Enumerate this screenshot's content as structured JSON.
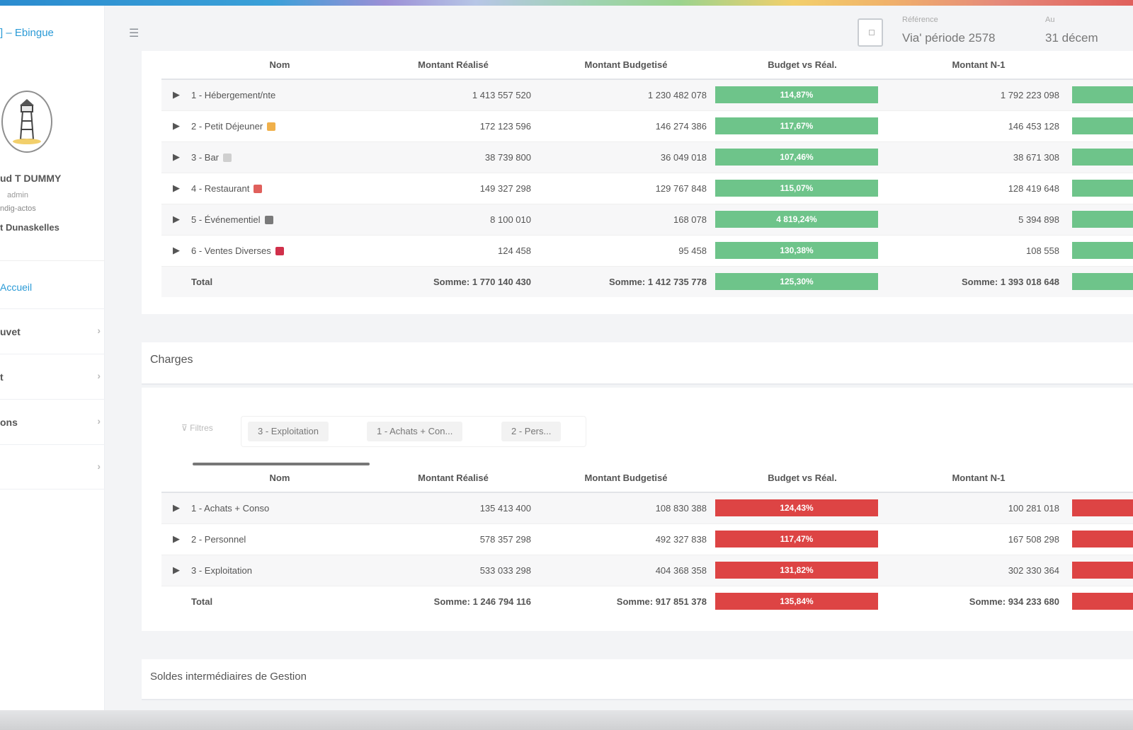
{
  "header": {
    "brand": "] – Ebingue",
    "date_label_1": "Référence",
    "date_value_1": "Via' période 2578",
    "date_label_2": "Au",
    "date_value_2": "31 décem"
  },
  "user": {
    "name": "ud T DUMMY",
    "role": "admin",
    "setting": "ndig-actos",
    "company": "t Dunaskelles"
  },
  "nav": {
    "active": "Accueil",
    "items": [
      {
        "label": "uvet"
      },
      {
        "label": "t"
      },
      {
        "label": "ons"
      },
      {
        "label": ""
      }
    ]
  },
  "table_headers": [
    "Nom",
    "Montant Réalisé",
    "Montant Budgetisé",
    "Budget vs Réal.",
    "Montant N-1"
  ],
  "produits": {
    "rows": [
      {
        "name": "1 - Hébergement/nte",
        "real": "1 413 557 520",
        "bud": "1 230 482 078",
        "pct": "114,87%",
        "n1": "1 792 223 098",
        "icon": ""
      },
      {
        "name": "2 - Petit Déjeuner",
        "real": "172 123 596",
        "bud": "146 274 386",
        "pct": "117,67%",
        "n1": "146 453 128",
        "icon": "#f0b04a"
      },
      {
        "name": "3 - Bar",
        "real": "38 739 800",
        "bud": "36 049 018",
        "pct": "107,46%",
        "n1": "38 671 308",
        "icon": "#cfcfcf"
      },
      {
        "name": "4 - Restaurant",
        "real": "149 327 298",
        "bud": "129 767 848",
        "pct": "115,07%",
        "n1": "128 419 648",
        "icon": "#e0605c"
      },
      {
        "name": "5 - Événementiel",
        "real": "8 100 010",
        "bud": "168 078",
        "pct": "4 819,24%",
        "n1": "5 394 898",
        "icon": "#7a7a7a"
      },
      {
        "name": "6 - Ventes Diverses",
        "real": "124 458",
        "bud": "95 458",
        "pct": "130,38%",
        "n1": "108 558",
        "icon": "#d0304a"
      }
    ],
    "total": {
      "label": "Total",
      "real": "Somme: 1 770 140 430",
      "bud": "Somme: 1 412 735 778",
      "pct": "125,30%",
      "n1": "Somme: 1 393 018 648"
    }
  },
  "charges": {
    "title": "Charges",
    "filter_label": "Filtres",
    "chips": [
      "3 - Exploitation",
      "1 - Achats + Con...",
      "2 - Pers..."
    ],
    "rows": [
      {
        "name": "1 - Achats + Conso",
        "real": "135 413 400",
        "bud": "108 830 388",
        "pct": "124,43%",
        "n1": "100 281 018"
      },
      {
        "name": "2 - Personnel",
        "real": "578 357 298",
        "bud": "492 327 838",
        "pct": "117,47%",
        "n1": "167 508 298"
      },
      {
        "name": "3 - Exploitation",
        "real": "533 033 298",
        "bud": "404 368 358",
        "pct": "131,82%",
        "n1": "302 330 364"
      }
    ],
    "total": {
      "label": "Total",
      "real": "Somme: 1 246 794 116",
      "bud": "Somme: 917 851 378",
      "pct": "135,84%",
      "n1": "Somme: 934 233 680"
    }
  },
  "section3": {
    "title": "Soldes intermédiaires de Gestion"
  },
  "colors": {
    "accent": "#2a9ad6",
    "good": "#6ec48a",
    "bad": "#dd4444"
  }
}
